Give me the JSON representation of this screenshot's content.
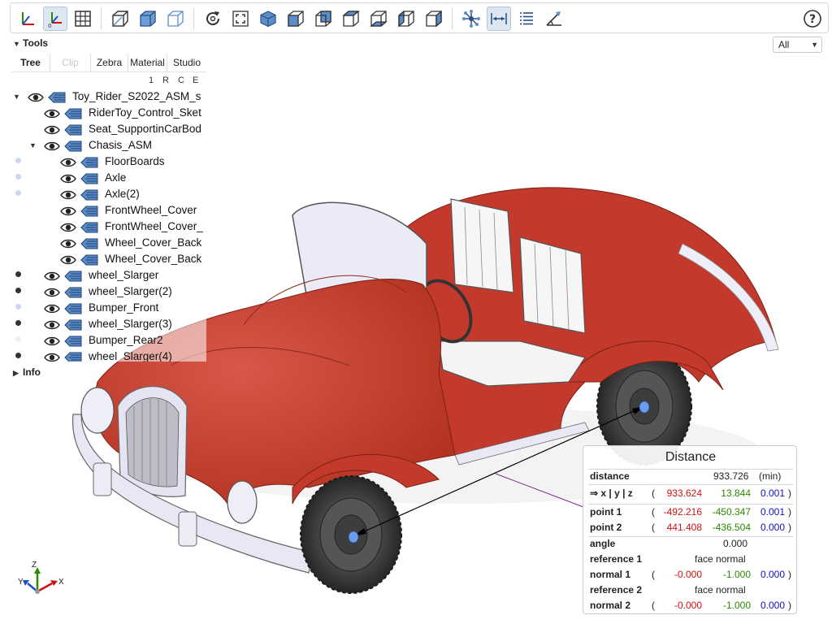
{
  "toolbar": {
    "buttons": [
      {
        "name": "axes-icon"
      },
      {
        "name": "axes-origin-icon"
      },
      {
        "name": "grid-icon"
      },
      {
        "name": "perspective-icon"
      },
      {
        "name": "transparent-icon"
      },
      {
        "name": "blackedges-icon"
      },
      {
        "name": "reset-icon"
      },
      {
        "name": "fit-icon"
      },
      {
        "name": "iso-view-icon"
      },
      {
        "name": "front-view-icon"
      },
      {
        "name": "rear-view-icon"
      },
      {
        "name": "top-view-icon"
      },
      {
        "name": "bottom-view-icon"
      },
      {
        "name": "left-view-icon"
      },
      {
        "name": "right-view-icon"
      },
      {
        "name": "explode-icon"
      },
      {
        "name": "distance-measure-icon"
      },
      {
        "name": "properties-icon"
      },
      {
        "name": "angle-measure-icon"
      }
    ],
    "help_icon": "help-icon"
  },
  "tools": {
    "title": "Tools",
    "tabs": [
      "Tree",
      "Clip",
      "Zebra",
      "Material",
      "Studio"
    ],
    "column_headers": [
      "1",
      "R",
      "C",
      "E"
    ]
  },
  "tree": {
    "rows": [
      {
        "label": "Toy_Rider_S2022_ASM_s",
        "indent": 0,
        "expander": "▼",
        "dot": ""
      },
      {
        "label": "RiderToy_Control_Sket",
        "indent": 1,
        "expander": "",
        "dot": ""
      },
      {
        "label": "Seat_SupportinCarBod",
        "indent": 1,
        "expander": "",
        "dot": ""
      },
      {
        "label": "Chasis_ASM",
        "indent": 1,
        "expander": "▼",
        "dot": ""
      },
      {
        "label": "FloorBoards",
        "indent": 2,
        "expander": "",
        "dot": "#cdd5f5"
      },
      {
        "label": "Axle",
        "indent": 2,
        "expander": "",
        "dot": "#cdd5f5"
      },
      {
        "label": "Axle(2)",
        "indent": 2,
        "expander": "",
        "dot": "#cdd5f5"
      },
      {
        "label": "FrontWheel_Cover",
        "indent": 2,
        "expander": "",
        "dot": ""
      },
      {
        "label": "FrontWheel_Cover_",
        "indent": 2,
        "expander": "",
        "dot": ""
      },
      {
        "label": "Wheel_Cover_Back",
        "indent": 2,
        "expander": "",
        "dot": ""
      },
      {
        "label": "Wheel_Cover_Back",
        "indent": 2,
        "expander": "",
        "dot": ""
      },
      {
        "label": "wheel_Slarger",
        "indent": 1,
        "expander": "",
        "dot": "#333333"
      },
      {
        "label": "wheel_Slarger(2)",
        "indent": 1,
        "expander": "",
        "dot": "#333333"
      },
      {
        "label": "Bumper_Front",
        "indent": 1,
        "expander": "",
        "dot": "#cdd5f5"
      },
      {
        "label": "wheel_Slarger(3)",
        "indent": 1,
        "expander": "",
        "dot": "#333333"
      },
      {
        "label": "Bumper_Rear2",
        "indent": 1,
        "expander": "",
        "dot": "#eeeeee"
      },
      {
        "label": "wheel_Slarger(4)",
        "indent": 1,
        "expander": "",
        "dot": "#333333"
      }
    ]
  },
  "info": {
    "title": "Info"
  },
  "filter": {
    "value": "All"
  },
  "axes_labels": {
    "x": "X",
    "y": "Y",
    "z": "Z"
  },
  "distance": {
    "title": "Distance",
    "distance_label": "distance",
    "distance_value": "933.726",
    "distance_unit": "(min)",
    "xyz_label": "⇒ x | y | z",
    "xyz": [
      "933.624",
      "13.844",
      "0.001"
    ],
    "point1_label": "point 1",
    "point1": [
      "-492.216",
      "-450.347",
      "0.001"
    ],
    "point2_label": "point 2",
    "point2": [
      "441.408",
      "-436.504",
      "0.000"
    ],
    "angle_label": "angle",
    "angle_value": "0.000",
    "reference1_label": "reference 1",
    "reference1_value": "face normal",
    "normal1_label": "normal 1",
    "normal1": [
      "-0.000",
      "-1.000",
      "0.000"
    ],
    "reference2_label": "reference 2",
    "reference2_value": "face normal",
    "normal2_label": "normal 2",
    "normal2": [
      "-0.000",
      "-1.000",
      "0.000"
    ],
    "paren_open": "(",
    "paren_close": ")"
  },
  "colors": {
    "body_red": "#c33a2c",
    "trim": "#e8e8f5",
    "tire": "#3a3a3a",
    "accent": "#5b8dc9"
  }
}
